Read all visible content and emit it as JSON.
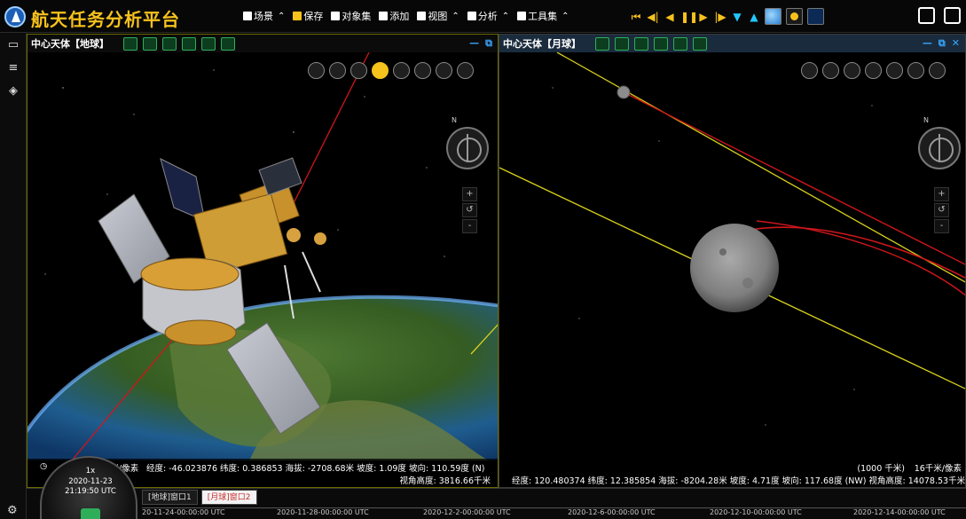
{
  "app": {
    "title": "航天任务分析平台"
  },
  "menu": [
    {
      "label": "场景",
      "has_caret": true
    },
    {
      "label": "保存",
      "has_caret": false
    },
    {
      "label": "对象集",
      "has_caret": false
    },
    {
      "label": "添加",
      "has_caret": false
    },
    {
      "label": "视图",
      "has_caret": true
    },
    {
      "label": "分析",
      "has_caret": true
    },
    {
      "label": "工具集",
      "has_caret": true
    }
  ],
  "playback": [
    "skip-start-icon",
    "step-back-icon",
    "play-reverse-icon",
    "pause-icon",
    "play-icon",
    "step-forward-icon",
    "skip-end-icon",
    "speed-up-icon",
    "globe-icon",
    "sun-icon",
    "moon-icon"
  ],
  "views": {
    "earth": {
      "label": "中心天体【地球】",
      "scale_fragment": "千米/像素",
      "status": "经度: -46.023876 纬度: 0.386853 海拔: -2708.68米 坡度: 1.09度 坡向: 110.59度 (N)",
      "camera_height": "视角高度: 3816.66千米"
    },
    "moon": {
      "label": "中心天体【月球】",
      "scale_bar": "(1000 千米)",
      "scale_value": "16千米/像素",
      "status": "经度: 120.480374 纬度: 12.385854 海拔: -8204.28米 坡度: 4.71度 坡向: 117.68度 (NW) 视角高度: 14078.53千米"
    }
  },
  "compass_letter": "N",
  "timeline": {
    "tabs": [
      {
        "label": "[地球]窗口1",
        "active": false
      },
      {
        "label": "[月球]窗口2",
        "active": true
      }
    ],
    "ticks": [
      "20-11-24-00:00:00 UTC",
      "2020-11-28-00:00:00 UTC",
      "2020-12-2-00:00:00 UTC",
      "2020-12-6-00:00:00 UTC",
      "2020-12-10-00:00:00 UTC",
      "2020-12-14-00:00:00 UTC"
    ],
    "clock": {
      "speed": "1x",
      "date": "2020-11-23",
      "time": "21:19:50 UTC"
    }
  },
  "colors": {
    "accent": "#f6c21c",
    "highlight": "#3aa7ff",
    "orbit_red": "#d0161a",
    "orbit_yellow": "#d8d11a"
  }
}
